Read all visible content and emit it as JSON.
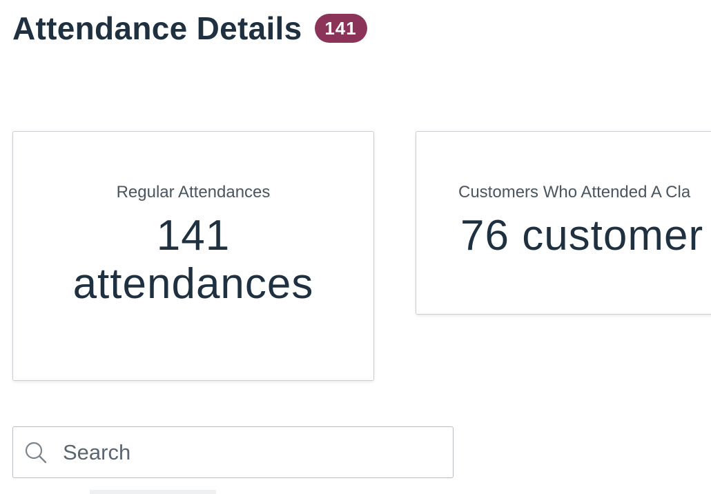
{
  "header": {
    "title": "Attendance Details",
    "badge_count": "141"
  },
  "cards": [
    {
      "label": "Regular Attendances",
      "value_line1": "141",
      "value_line2": "attendances"
    },
    {
      "label": "Customers Who Attended A Cla",
      "value": "76 customer"
    }
  ],
  "search": {
    "placeholder": "Search"
  },
  "colors": {
    "badge": "#8c3359",
    "title": "#1f3040",
    "border": "#c9cdd1"
  }
}
